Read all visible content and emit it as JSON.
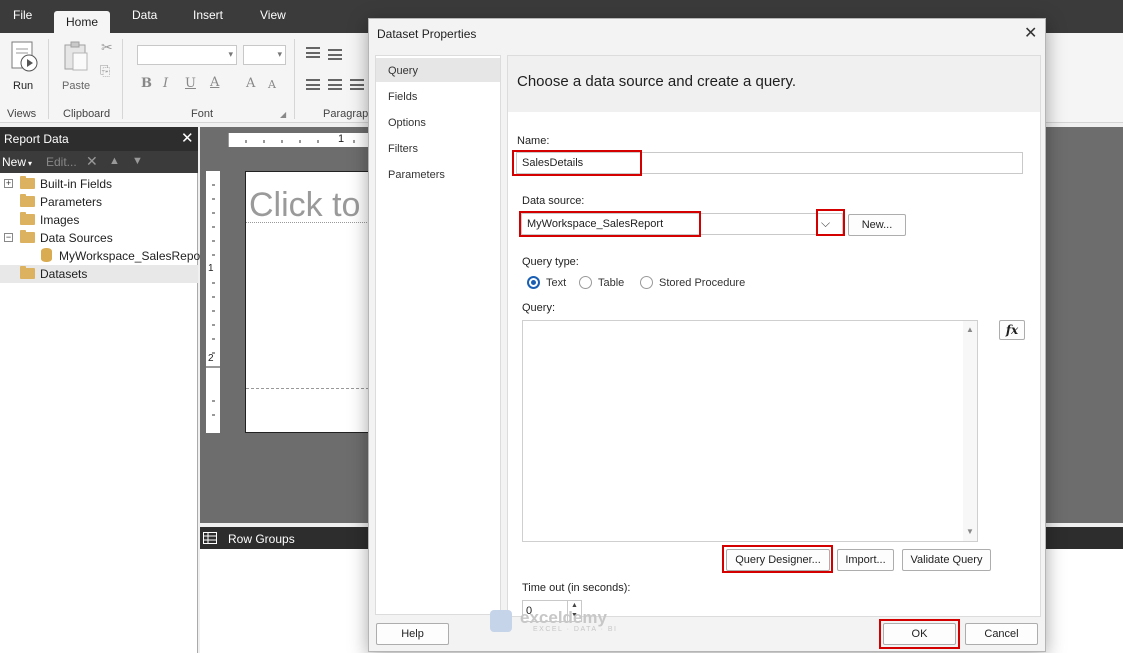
{
  "ribbon": {
    "tabs": [
      "File",
      "Home",
      "Data",
      "Insert",
      "View"
    ],
    "active_tab": "Home",
    "run_label": "Run",
    "paste_label": "Paste",
    "groups": [
      "Views",
      "Clipboard",
      "Font",
      "Paragrap"
    ]
  },
  "report_data": {
    "title": "Report Data",
    "toolbar": {
      "new_label": "New",
      "edit_label": "Edit..."
    },
    "tree": [
      {
        "label": "Built-in Fields",
        "icon": "folder-icon",
        "expandable": true
      },
      {
        "label": "Parameters",
        "icon": "folder-icon"
      },
      {
        "label": "Images",
        "icon": "folder-icon"
      },
      {
        "label": "Data Sources",
        "icon": "folder-open-icon",
        "expandable": true
      },
      {
        "label": "MyWorkspace_SalesReport",
        "icon": "database-icon",
        "child": true
      },
      {
        "label": "Datasets",
        "icon": "folder-icon",
        "selected": true
      }
    ]
  },
  "design": {
    "placeholder": "Click to",
    "ruler_marks": [
      "1",
      "1",
      "2"
    ]
  },
  "row_groups": {
    "label": "Row Groups"
  },
  "dialog": {
    "title": "Dataset Properties",
    "nav": [
      "Query",
      "Fields",
      "Options",
      "Filters",
      "Parameters"
    ],
    "active_nav": "Query",
    "heading": "Choose a data source and create a query.",
    "name_label": "Name:",
    "name_value": "SalesDetails",
    "datasource_label": "Data source:",
    "datasource_value": "MyWorkspace_SalesReport",
    "new_button": "New...",
    "query_type_label": "Query type:",
    "query_types": [
      "Text",
      "Table",
      "Stored Procedure"
    ],
    "selected_query_type": "Text",
    "query_label": "Query:",
    "fx_label": "fx",
    "query_designer_button": "Query Designer...",
    "import_button": "Import...",
    "validate_button": "Validate Query",
    "timeout_label": "Time out (in seconds):",
    "timeout_value": "0",
    "help_button": "Help",
    "ok_button": "OK",
    "cancel_button": "Cancel",
    "highlight_color": "#d40000",
    "accent_color": "#1b5fb4"
  },
  "watermark": {
    "name": "exceldemy",
    "tagline": "EXCEL · DATA · BI"
  }
}
